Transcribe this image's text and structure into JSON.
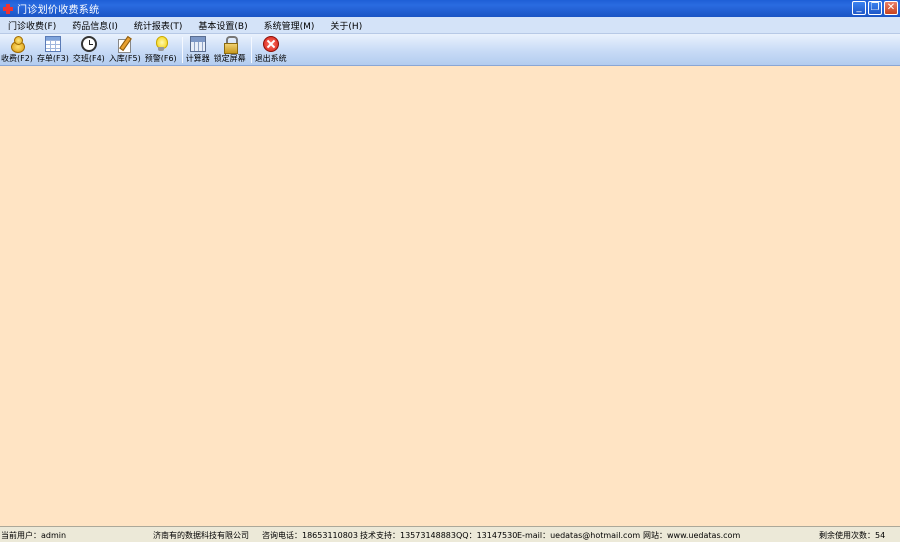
{
  "window": {
    "title": "门诊划价收费系统",
    "buttons": {
      "minimize": "_",
      "restore": "❐",
      "close": "✕"
    }
  },
  "menu": [
    {
      "label": "门诊收费(F)"
    },
    {
      "label": "药品信息(I)"
    },
    {
      "label": "统计报表(T)"
    },
    {
      "label": "基本设置(B)"
    },
    {
      "label": "系统管理(M)"
    },
    {
      "label": "关于(H)"
    }
  ],
  "toolbar": [
    {
      "label": "收费(F2)",
      "icon": "coins-icon"
    },
    {
      "label": "存单(F3)",
      "icon": "table-icon"
    },
    {
      "label": "交班(F4)",
      "icon": "clock-icon"
    },
    {
      "label": "入库(F5)",
      "icon": "pencil-icon"
    },
    {
      "label": "预警(F6)",
      "icon": "bulb-icon"
    },
    {
      "label": "计算器",
      "icon": "calculator-icon"
    },
    {
      "label": "锁定屏幕",
      "icon": "lock-icon"
    },
    {
      "label": "退出系统",
      "icon": "exit-icon"
    }
  ],
  "colors": {
    "main_background": "#ffe4c4",
    "titlebar": "#1e5fd6",
    "menubar": "#d4e3f8"
  },
  "status": {
    "current_user": "当前用户：admin",
    "company": "济南有的数据科技有限公司",
    "phone": "咨询电话：18653110803",
    "support": "技术支持：13573148883",
    "qq": "QQ：13147530",
    "email": "E-mail：uedatas@hotmail.com",
    "website": "网站：www.uedatas.com",
    "remaining": "剩余使用次数：54"
  }
}
